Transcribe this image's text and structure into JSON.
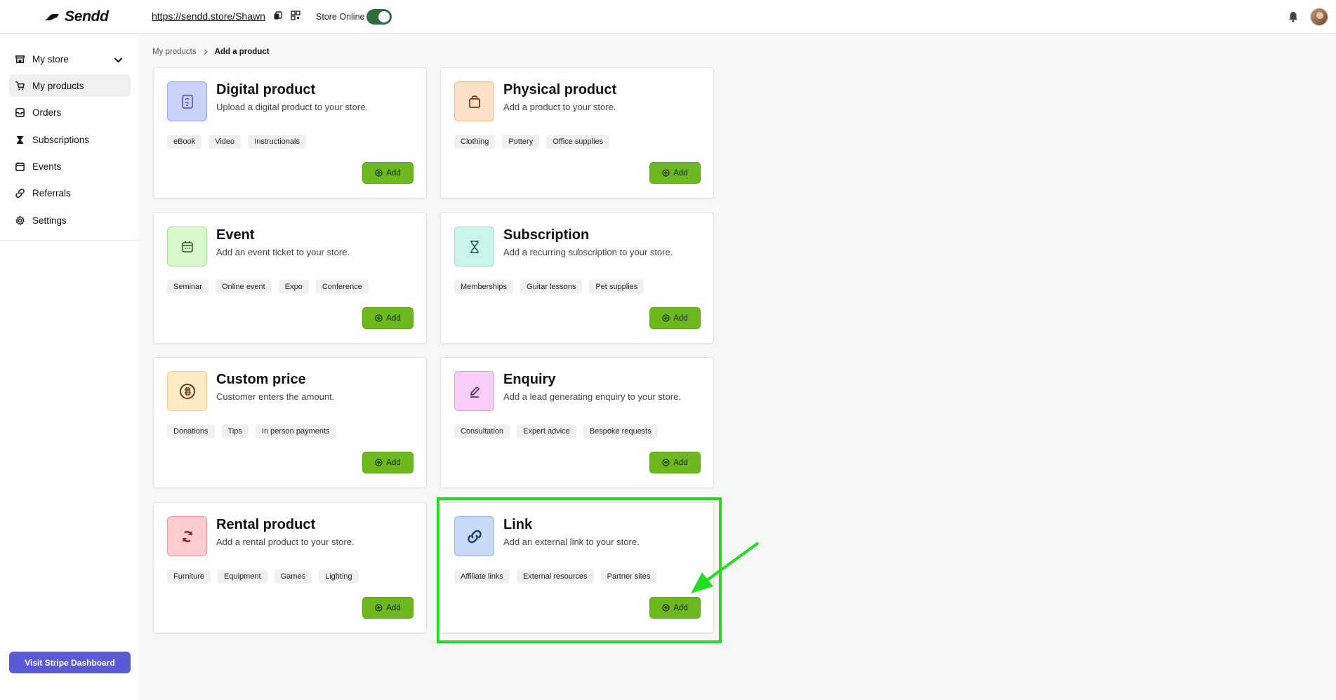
{
  "header": {
    "logo_text": "Sendd",
    "store_url": "https://sendd.store/Shawn",
    "store_online_label": "Store Online",
    "store_online": true
  },
  "sidebar": {
    "items": [
      {
        "label": "My store",
        "icon": "store-icon"
      },
      {
        "label": "My products",
        "icon": "cart-icon"
      },
      {
        "label": "Orders",
        "icon": "inbox-icon"
      },
      {
        "label": "Subscriptions",
        "icon": "hourglass-icon"
      },
      {
        "label": "Events",
        "icon": "calendar-icon"
      },
      {
        "label": "Referrals",
        "icon": "link-icon"
      },
      {
        "label": "Settings",
        "icon": "gear-icon"
      }
    ],
    "stripe_button": "Visit Stripe Dashboard"
  },
  "breadcrumb": {
    "parent": "My products",
    "current": "Add a product"
  },
  "add_label": "Add",
  "cards": [
    {
      "title": "Digital product",
      "desc": "Upload a digital product to your store.",
      "tags": [
        "eBook",
        "Video",
        "Instructionals"
      ],
      "icon": "document-icon",
      "icon_bg": "#c9d2fb",
      "icon_border": "#9aa8f0"
    },
    {
      "title": "Physical product",
      "desc": "Add a product to your store.",
      "tags": [
        "Clothing",
        "Pottery",
        "Office supplies"
      ],
      "icon": "bag-icon",
      "icon_bg": "#fde0c8",
      "icon_border": "#f5b98a"
    },
    {
      "title": "Event",
      "desc": "Add an event ticket to your store.",
      "tags": [
        "Seminar",
        "Online event",
        "Expo",
        "Conference"
      ],
      "icon": "calendar-icon",
      "icon_bg": "#d7f7cd",
      "icon_border": "#a6e497"
    },
    {
      "title": "Subscription",
      "desc": "Add a recurring subscription to your store.",
      "tags": [
        "Memberships",
        "Guitar lessons",
        "Pet supplies"
      ],
      "icon": "hourglass-icon",
      "icon_bg": "#c9f5ea",
      "icon_border": "#8fe3cf"
    },
    {
      "title": "Custom price",
      "desc": "Customer enters the amount.",
      "tags": [
        "Donations",
        "Tips",
        "In person payments"
      ],
      "icon": "coin-icon",
      "icon_bg": "#fdebc6",
      "icon_border": "#f3cc84"
    },
    {
      "title": "Enquiry",
      "desc": "Add a lead generating enquiry to your store.",
      "tags": [
        "Consultation",
        "Expert advice",
        "Bespoke requests"
      ],
      "icon": "pencil-icon",
      "icon_bg": "#f8cdf8",
      "icon_border": "#e794e7"
    },
    {
      "title": "Rental product",
      "desc": "Add a rental product to your store.",
      "tags": [
        "Furniture",
        "Equipment",
        "Games",
        "Lighting"
      ],
      "icon": "refresh-icon",
      "icon_bg": "#fbcdd0",
      "icon_border": "#f09aa0"
    },
    {
      "title": "Link",
      "desc": "Add an external link to your store.",
      "tags": [
        "Affiliate links",
        "External resources",
        "Partner sites"
      ],
      "icon": "link-icon",
      "icon_bg": "#c9daf8",
      "icon_border": "#8fb0ea"
    }
  ],
  "colors": {
    "accent_green": "#6cb81e",
    "stripe_button": "#5b5bd6",
    "highlight": "#22dd22"
  }
}
